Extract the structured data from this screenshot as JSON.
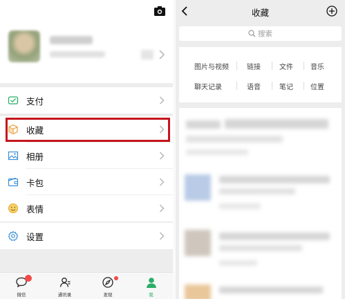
{
  "left": {
    "menu_top": [
      {
        "name": "menu-pay",
        "label": "支付",
        "icon": "pay-icon"
      }
    ],
    "menu_main": [
      {
        "name": "menu-favorites",
        "label": "收藏",
        "icon": "favorites-icon"
      },
      {
        "name": "menu-album",
        "label": "相册",
        "icon": "album-icon"
      },
      {
        "name": "menu-cards",
        "label": "卡包",
        "icon": "card-wallet-icon"
      },
      {
        "name": "menu-stickers",
        "label": "表情",
        "icon": "sticker-icon"
      }
    ],
    "menu_settings": [
      {
        "name": "menu-settings",
        "label": "设置",
        "icon": "settings-icon"
      }
    ],
    "tabs": [
      {
        "label": "微信",
        "icon": "chat-icon",
        "badge": true
      },
      {
        "label": "通讯录",
        "icon": "contacts-icon",
        "badge": false
      },
      {
        "label": "发现",
        "icon": "discover-icon",
        "badge": true
      },
      {
        "label": "我",
        "icon": "me-icon",
        "badge": false,
        "active": true
      }
    ],
    "colors": {
      "highlight": "#c6141c",
      "active_tab": "#2aae67"
    }
  },
  "right": {
    "title": "收藏",
    "search_placeholder": "搜索",
    "categories": [
      [
        "图片与视频",
        "链接",
        "文件",
        "音乐"
      ],
      [
        "聊天记录",
        "语音",
        "笔记",
        "位置"
      ]
    ]
  }
}
